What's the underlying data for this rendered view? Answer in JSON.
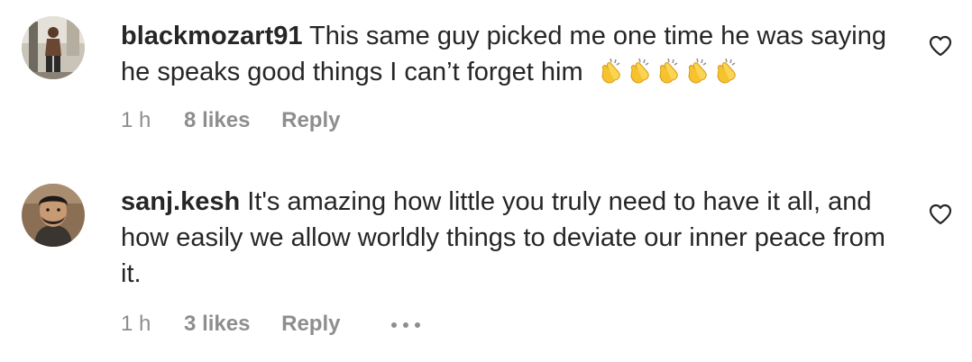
{
  "comments": [
    {
      "username": "blackmozart91",
      "text": "This same guy picked me one time he was saying he speaks good things I can’t forget him",
      "emoji": "👏👏👏👏👏",
      "time": "1 h",
      "likes": "8 likes",
      "reply_label": "Reply",
      "avatar_icon": "avatar-photo"
    },
    {
      "username": "sanj.kesh",
      "text": "It's amazing how little you truly need to have it all, and how easily we allow worldly things to deviate our inner peace from it.",
      "time": "1 h",
      "likes": "3 likes",
      "reply_label": "Reply",
      "avatar_icon": "avatar-photo"
    }
  ],
  "icons": {
    "like": "heart-outline-icon",
    "more": "more-options-icon"
  },
  "colors": {
    "text": "#262626",
    "meta": "#8e8e8e",
    "clap": "#f6c22e"
  }
}
